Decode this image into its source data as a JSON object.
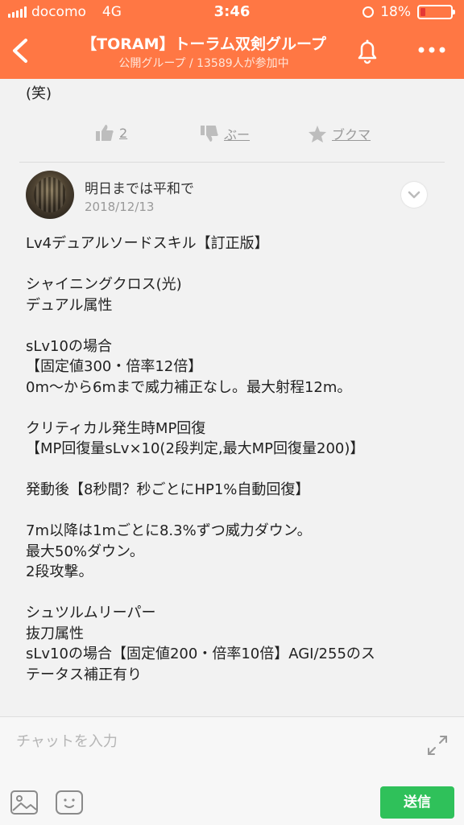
{
  "status_bar": {
    "carrier": "docomo",
    "network": "4G",
    "time": "3:46",
    "battery": "18%",
    "battery_level": 0.18
  },
  "header": {
    "title": "【TORAM】トーラム双剣グループ",
    "subtitle": "公開グループ / 13589人が参加中"
  },
  "prev_post": {
    "text_tail": "(笑)",
    "actions": {
      "like_count": "2",
      "dislike_label": "ぶー",
      "bookmark_label": "ブクマ"
    }
  },
  "post": {
    "author": "明日までは平和で",
    "date": "2018/12/13",
    "lines": [
      "Lv4デュアルソードスキル【訂正版】",
      "",
      "シャイニングクロス(光)",
      "デュアル属性",
      "",
      "sLv10の場合",
      "【固定値300・倍率12倍】",
      "0m〜から6mまで威力補正なし。最大射程12m。",
      "",
      "クリティカル発生時MP回復",
      "【MP回復量sLv×10(2段判定,最大MP回復量200)】",
      "",
      "発動後【8秒間？秒ごとにHP1%自動回復】",
      "",
      "7m以降は1mごとに8.3%ずつ威力ダウン。",
      "最大50%ダウン。",
      "2段攻撃。",
      "",
      "シュツルムリーパー",
      "抜刀属性",
      "sLv10の場合【固定値200・倍率10倍】AGI/255のス",
      "テータス補正有り"
    ]
  },
  "input": {
    "placeholder": "チャットを入力",
    "send_label": "送信"
  },
  "colors": {
    "header_bg": "#ff7744",
    "send_bg": "#2fc15a"
  }
}
